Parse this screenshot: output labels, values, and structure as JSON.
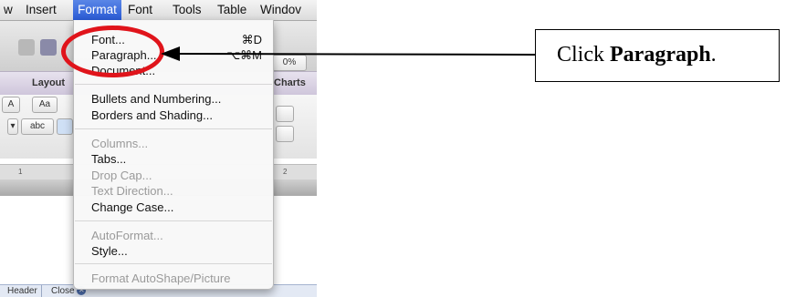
{
  "menubar": {
    "items": [
      "w",
      "Insert",
      "Format",
      "Font",
      "Tools",
      "Table",
      "Windov"
    ],
    "active": "Format"
  },
  "ribbon": {
    "tabs": [
      "Layout",
      "Charts"
    ],
    "zoom_partial": "0%"
  },
  "ruler": {
    "marks": [
      "1",
      "2"
    ]
  },
  "statusbar": {
    "header_label": "Header",
    "close_label": "Close"
  },
  "format_menu": {
    "items": [
      {
        "label": "Font...",
        "shortcut": "⌘D",
        "enabled": true
      },
      {
        "label": "Paragraph...",
        "shortcut": "⌥⌘M",
        "enabled": true
      },
      {
        "label": "Document...",
        "shortcut": "",
        "enabled": true
      },
      {
        "label": "Bullets and Numbering...",
        "shortcut": "",
        "enabled": true
      },
      {
        "label": "Borders and Shading...",
        "shortcut": "",
        "enabled": true
      },
      {
        "label": "Columns...",
        "shortcut": "",
        "enabled": false
      },
      {
        "label": "Tabs...",
        "shortcut": "",
        "enabled": true
      },
      {
        "label": "Drop Cap...",
        "shortcut": "",
        "enabled": false
      },
      {
        "label": "Text Direction...",
        "shortcut": "",
        "enabled": false
      },
      {
        "label": "Change Case...",
        "shortcut": "",
        "enabled": true
      },
      {
        "label": "AutoFormat...",
        "shortcut": "",
        "enabled": false
      },
      {
        "label": "Style...",
        "shortcut": "",
        "enabled": true
      },
      {
        "label": "Format AutoShape/Picture",
        "shortcut": "",
        "enabled": false
      }
    ]
  },
  "callout": {
    "prefix": "Click ",
    "bold": "Paragraph",
    "suffix": "."
  },
  "colors": {
    "highlight_red": "#e0141b",
    "menu_active_blue": "#2a5bd6"
  }
}
